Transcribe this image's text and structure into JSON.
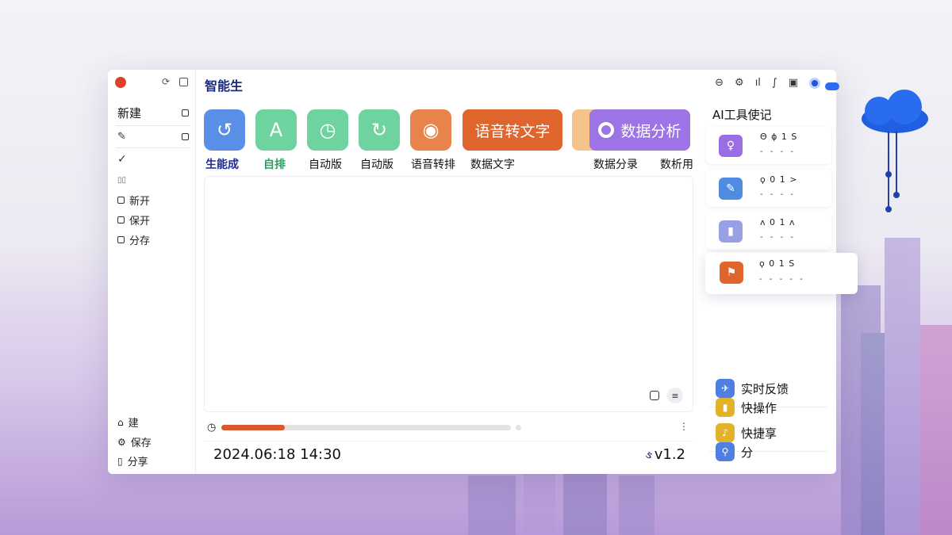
{
  "app": {
    "title": "智能生"
  },
  "sidebar": {
    "top_items": [
      {
        "label": "新建"
      }
    ],
    "menu": [
      {
        "label": "新开"
      },
      {
        "label": "保开"
      },
      {
        "label": "分存"
      }
    ],
    "bottom": [
      {
        "label": "建"
      },
      {
        "label": "保存"
      },
      {
        "label": "分享"
      }
    ]
  },
  "toolbar": {
    "tools": [
      {
        "label": "生能成",
        "glyph": "↺",
        "color": "#5b8ee6"
      },
      {
        "label": "自排",
        "glyph": "A",
        "color": "#6fd3a0"
      },
      {
        "label": "自动版",
        "glyph": "◷",
        "color": "#6fd3a0"
      },
      {
        "label": "自动版",
        "glyph": "↻",
        "color": "#6fd3a0"
      },
      {
        "label": "语音转排",
        "glyph": "◉",
        "color": "#e8834c"
      }
    ],
    "pill_speech": {
      "text": "语音转文字",
      "sub": "数据文字",
      "color": "#e0652c"
    },
    "pill_data": {
      "text": "数据分析",
      "color": "#9c74e6"
    },
    "extra_labels": [
      "数据分录",
      "数析用"
    ]
  },
  "status": {
    "datetime": "2024.06:18  14:30",
    "version": "v1.2",
    "progress": 0.22
  },
  "right_panel": {
    "title": "AI工具使记",
    "cards": [
      {
        "color": "#9b6ee6",
        "t1": "Θ ϕ 1 S",
        "t2": "- - - -"
      },
      {
        "color": "#4f8be0",
        "t1": "ϙ 0 1 >",
        "t2": "- - - -"
      },
      {
        "color": "#9aa0e6",
        "t1": "ʌ 0 1 ʌ",
        "t2": "- - - -"
      },
      {
        "color": "#e0652c",
        "t1": "ϙ 0 1 S",
        "t2": "- - - - -"
      }
    ],
    "actions": [
      {
        "label": "实时反馈",
        "color": "#4f7fe3"
      },
      {
        "label": "快捷享",
        "color": "#e2b22a"
      },
      {
        "label": "快操作",
        "color": "#e2b22a"
      },
      {
        "label": "分",
        "color": "#4f7fe3"
      }
    ]
  }
}
